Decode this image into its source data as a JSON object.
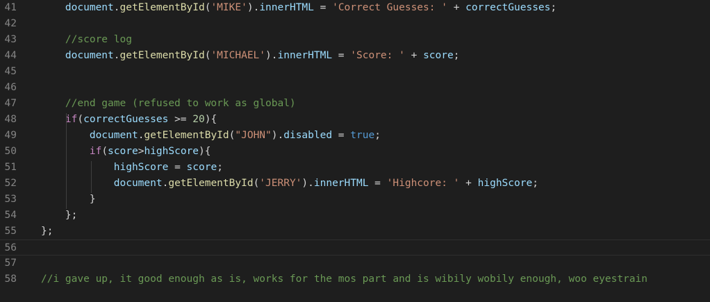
{
  "editor": {
    "lines": [
      {
        "number": "41",
        "segments": [
          {
            "text": "    ",
            "type": "plain"
          },
          {
            "text": "document",
            "type": "var"
          },
          {
            "text": ".",
            "type": "plain"
          },
          {
            "text": "getElementById",
            "type": "fn"
          },
          {
            "text": "(",
            "type": "plain"
          },
          {
            "text": "'MIKE'",
            "type": "str"
          },
          {
            "text": ").",
            "type": "plain"
          },
          {
            "text": "innerHTML",
            "type": "var"
          },
          {
            "text": " = ",
            "type": "plain"
          },
          {
            "text": "'Correct Guesses: '",
            "type": "str"
          },
          {
            "text": " + ",
            "type": "plain"
          },
          {
            "text": "correctGuesses",
            "type": "var"
          },
          {
            "text": ";",
            "type": "plain"
          }
        ]
      },
      {
        "number": "42",
        "segments": []
      },
      {
        "number": "43",
        "segments": [
          {
            "text": "    ",
            "type": "plain"
          },
          {
            "text": "//score log",
            "type": "comment"
          }
        ]
      },
      {
        "number": "44",
        "segments": [
          {
            "text": "    ",
            "type": "plain"
          },
          {
            "text": "document",
            "type": "var"
          },
          {
            "text": ".",
            "type": "plain"
          },
          {
            "text": "getElementById",
            "type": "fn"
          },
          {
            "text": "(",
            "type": "plain"
          },
          {
            "text": "'MICHAEL'",
            "type": "str"
          },
          {
            "text": ").",
            "type": "plain"
          },
          {
            "text": "innerHTML",
            "type": "var"
          },
          {
            "text": " = ",
            "type": "plain"
          },
          {
            "text": "'Score: '",
            "type": "str"
          },
          {
            "text": " + ",
            "type": "plain"
          },
          {
            "text": "score",
            "type": "var"
          },
          {
            "text": ";",
            "type": "plain"
          }
        ]
      },
      {
        "number": "45",
        "segments": []
      },
      {
        "number": "46",
        "segments": []
      },
      {
        "number": "47",
        "segments": [
          {
            "text": "    ",
            "type": "plain"
          },
          {
            "text": "//end game (refused to work as global)",
            "type": "comment"
          }
        ]
      },
      {
        "number": "48",
        "segments": [
          {
            "text": "    ",
            "type": "plain"
          },
          {
            "text": "if",
            "type": "kw"
          },
          {
            "text": "(",
            "type": "plain"
          },
          {
            "text": "correctGuesses",
            "type": "var"
          },
          {
            "text": " >= ",
            "type": "plain"
          },
          {
            "text": "20",
            "type": "num"
          },
          {
            "text": "){",
            "type": "plain"
          }
        ]
      },
      {
        "number": "49",
        "segments": [
          {
            "text": "        ",
            "type": "plain"
          },
          {
            "text": "document",
            "type": "var"
          },
          {
            "text": ".",
            "type": "plain"
          },
          {
            "text": "getElementById",
            "type": "fn"
          },
          {
            "text": "(",
            "type": "plain"
          },
          {
            "text": "\"JOHN\"",
            "type": "str"
          },
          {
            "text": ").",
            "type": "plain"
          },
          {
            "text": "disabled",
            "type": "var"
          },
          {
            "text": " = ",
            "type": "plain"
          },
          {
            "text": "true",
            "type": "bool"
          },
          {
            "text": ";",
            "type": "plain"
          }
        ]
      },
      {
        "number": "50",
        "segments": [
          {
            "text": "        ",
            "type": "plain"
          },
          {
            "text": "if",
            "type": "kw"
          },
          {
            "text": "(",
            "type": "plain"
          },
          {
            "text": "score",
            "type": "var"
          },
          {
            "text": ">",
            "type": "plain"
          },
          {
            "text": "highScore",
            "type": "var"
          },
          {
            "text": "){",
            "type": "plain"
          }
        ]
      },
      {
        "number": "51",
        "segments": [
          {
            "text": "            ",
            "type": "plain"
          },
          {
            "text": "highScore",
            "type": "var"
          },
          {
            "text": " = ",
            "type": "plain"
          },
          {
            "text": "score",
            "type": "var"
          },
          {
            "text": ";",
            "type": "plain"
          }
        ]
      },
      {
        "number": "52",
        "segments": [
          {
            "text": "            ",
            "type": "plain"
          },
          {
            "text": "document",
            "type": "var"
          },
          {
            "text": ".",
            "type": "plain"
          },
          {
            "text": "getElementById",
            "type": "fn"
          },
          {
            "text": "(",
            "type": "plain"
          },
          {
            "text": "'JERRY'",
            "type": "str"
          },
          {
            "text": ").",
            "type": "plain"
          },
          {
            "text": "innerHTML",
            "type": "var"
          },
          {
            "text": " = ",
            "type": "plain"
          },
          {
            "text": "'Highcore: '",
            "type": "str"
          },
          {
            "text": " + ",
            "type": "plain"
          },
          {
            "text": "highScore",
            "type": "var"
          },
          {
            "text": ";",
            "type": "plain"
          }
        ]
      },
      {
        "number": "53",
        "segments": [
          {
            "text": "        ",
            "type": "plain"
          },
          {
            "text": "}",
            "type": "plain"
          }
        ]
      },
      {
        "number": "54",
        "segments": [
          {
            "text": "    ",
            "type": "plain"
          },
          {
            "text": "};",
            "type": "plain"
          }
        ]
      },
      {
        "number": "55",
        "segments": [
          {
            "text": "};",
            "type": "plain"
          }
        ]
      },
      {
        "number": "56",
        "segments": [],
        "current": true
      },
      {
        "number": "57",
        "segments": []
      },
      {
        "number": "58",
        "segments": [
          {
            "text": "//i gave up, it good enough as is, works for the mos part and is wibily wobily enough, woo eyestrain",
            "type": "comment"
          }
        ]
      }
    ]
  }
}
